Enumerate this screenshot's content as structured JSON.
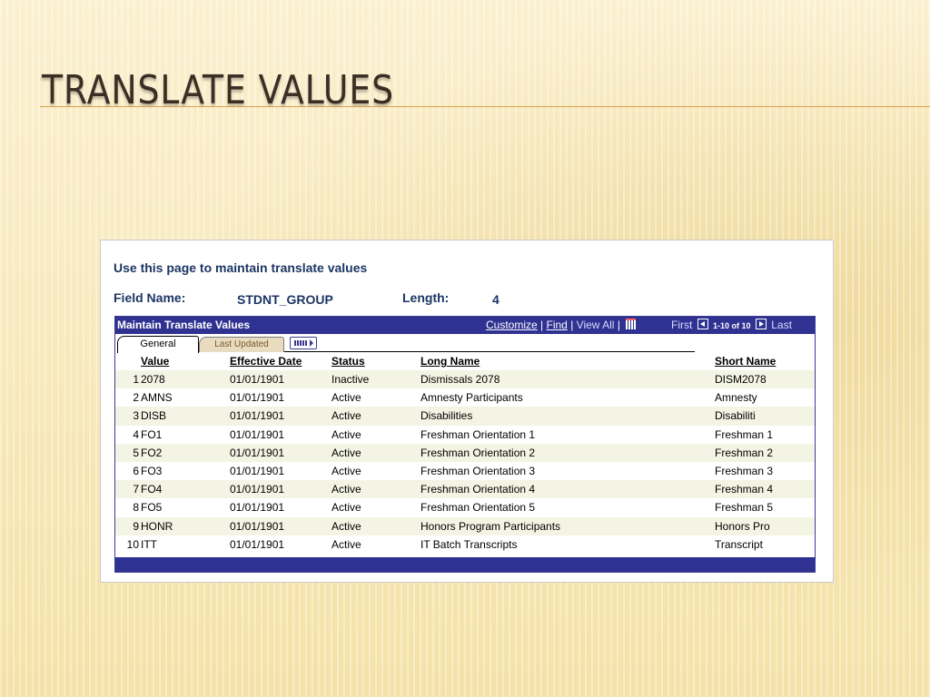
{
  "slide": {
    "title": "TRANSLATE VALUES"
  },
  "page": {
    "instruction": "Use this page to maintain translate values",
    "field_name_label": "Field Name:",
    "field_name_value": "STDNT_GROUP",
    "length_label": "Length:",
    "length_value": "4"
  },
  "grid": {
    "title": "Maintain Translate Values",
    "links": {
      "customize": "Customize",
      "find": "Find",
      "view_all": "View All"
    },
    "pager": {
      "first": "First",
      "range": "1-10 of 10",
      "last": "Last"
    },
    "tabs": {
      "general": "General",
      "last_updated": "Last Updated"
    },
    "columns": {
      "value": "Value",
      "effective_date": "Effective Date",
      "status": "Status",
      "long_name": "Long Name",
      "short_name": "Short Name"
    },
    "rows": [
      {
        "num": "1",
        "value": "2078",
        "date": "01/01/1901",
        "status": "Inactive",
        "long": "Dismissals 2078",
        "short": "DISM2078"
      },
      {
        "num": "2",
        "value": "AMNS",
        "date": "01/01/1901",
        "status": "Active",
        "long": "Amnesty Participants",
        "short": "Amnesty"
      },
      {
        "num": "3",
        "value": "DISB",
        "date": "01/01/1901",
        "status": "Active",
        "long": "Disabilities",
        "short": "Disabiliti"
      },
      {
        "num": "4",
        "value": "FO1",
        "date": "01/01/1901",
        "status": "Active",
        "long": "Freshman Orientation 1",
        "short": "Freshman 1"
      },
      {
        "num": "5",
        "value": "FO2",
        "date": "01/01/1901",
        "status": "Active",
        "long": "Freshman Orientation 2",
        "short": "Freshman 2"
      },
      {
        "num": "6",
        "value": "FO3",
        "date": "01/01/1901",
        "status": "Active",
        "long": "Freshman Orientation 3",
        "short": "Freshman 3"
      },
      {
        "num": "7",
        "value": "FO4",
        "date": "01/01/1901",
        "status": "Active",
        "long": "Freshman Orientation 4",
        "short": "Freshman 4"
      },
      {
        "num": "8",
        "value": "FO5",
        "date": "01/01/1901",
        "status": "Active",
        "long": "Freshman Orientation 5",
        "short": "Freshman 5"
      },
      {
        "num": "9",
        "value": "HONR",
        "date": "01/01/1901",
        "status": "Active",
        "long": "Honors Program Participants",
        "short": "Honors Pro"
      },
      {
        "num": "10",
        "value": "ITT",
        "date": "01/01/1901",
        "status": "Active",
        "long": "IT Batch Transcripts",
        "short": "Transcript"
      }
    ]
  },
  "icons": {
    "view_all": "grid-icon",
    "first": "arrow-left-icon",
    "last": "arrow-right-icon",
    "more_tabs": "show-all-columns-icon"
  },
  "colors": {
    "header": "#2f3291",
    "title_text": "#3b2f25",
    "label_text": "#1c3663",
    "accent_rule": "#d9a24a"
  }
}
